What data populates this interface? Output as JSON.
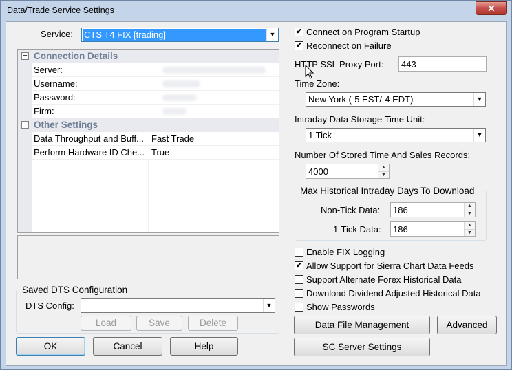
{
  "window": {
    "title": "Data/Trade Service Settings",
    "close_label": "✕"
  },
  "service": {
    "label": "Service:",
    "value": "CTS T4 FIX   [trading]"
  },
  "grid": {
    "categories": [
      {
        "name": "Connection Details",
        "rows": [
          {
            "key": "Server:",
            "value": ""
          },
          {
            "key": "Username:",
            "value": ""
          },
          {
            "key": "Password:",
            "value": ""
          },
          {
            "key": "Firm:",
            "value": ""
          }
        ]
      },
      {
        "name": "Other Settings",
        "rows": [
          {
            "key": "Data Throughput and Buff...",
            "value": "Fast Trade"
          },
          {
            "key": "Perform Hardware ID Che...",
            "value": "True"
          }
        ]
      }
    ],
    "toggle_symbol": "⊟"
  },
  "saved_dts": {
    "group_title": "Saved DTS Configuration",
    "config_label": "DTS Config:",
    "config_value": "",
    "load": "Load",
    "save": "Save",
    "delete": "Delete"
  },
  "bottom_buttons": {
    "ok": "OK",
    "cancel": "Cancel",
    "help": "Help"
  },
  "right": {
    "connect_on_startup": {
      "label": "Connect on Program Startup",
      "checked": true
    },
    "reconnect_on_failure": {
      "label": "Reconnect on Failure",
      "checked": true
    },
    "http_ssl_proxy": {
      "label": "HTTP SSL Proxy Port:",
      "value": "443"
    },
    "time_zone": {
      "label": "Time Zone:",
      "value": "New York (-5 EST/-4 EDT)"
    },
    "intraday_unit": {
      "label": "Intraday Data Storage Time Unit:",
      "value": "1 Tick"
    },
    "stored_records": {
      "label": "Number Of Stored Time And Sales Records:",
      "value": "4000"
    },
    "max_hist": {
      "group_title": "Max Historical Intraday Days To Download",
      "non_tick_label": "Non-Tick Data:",
      "non_tick_value": "186",
      "one_tick_label": "1-Tick Data:",
      "one_tick_value": "186"
    },
    "checkboxes": [
      {
        "label": "Enable FIX Logging",
        "checked": false
      },
      {
        "label": "Allow Support for Sierra Chart Data Feeds",
        "checked": true
      },
      {
        "label": "Support Alternate Forex Historical Data",
        "checked": false
      },
      {
        "label": "Download Dividend Adjusted Historical Data",
        "checked": false
      },
      {
        "label": "Show Passwords",
        "checked": false
      }
    ],
    "data_file_management": "Data File Management",
    "advanced": "Advanced",
    "sc_server_settings": "SC Server Settings"
  },
  "icons": {
    "check": "✔",
    "dropdown": "▼",
    "spin_up": "▲",
    "spin_down": "▼",
    "cursor": "arrow-cursor"
  }
}
